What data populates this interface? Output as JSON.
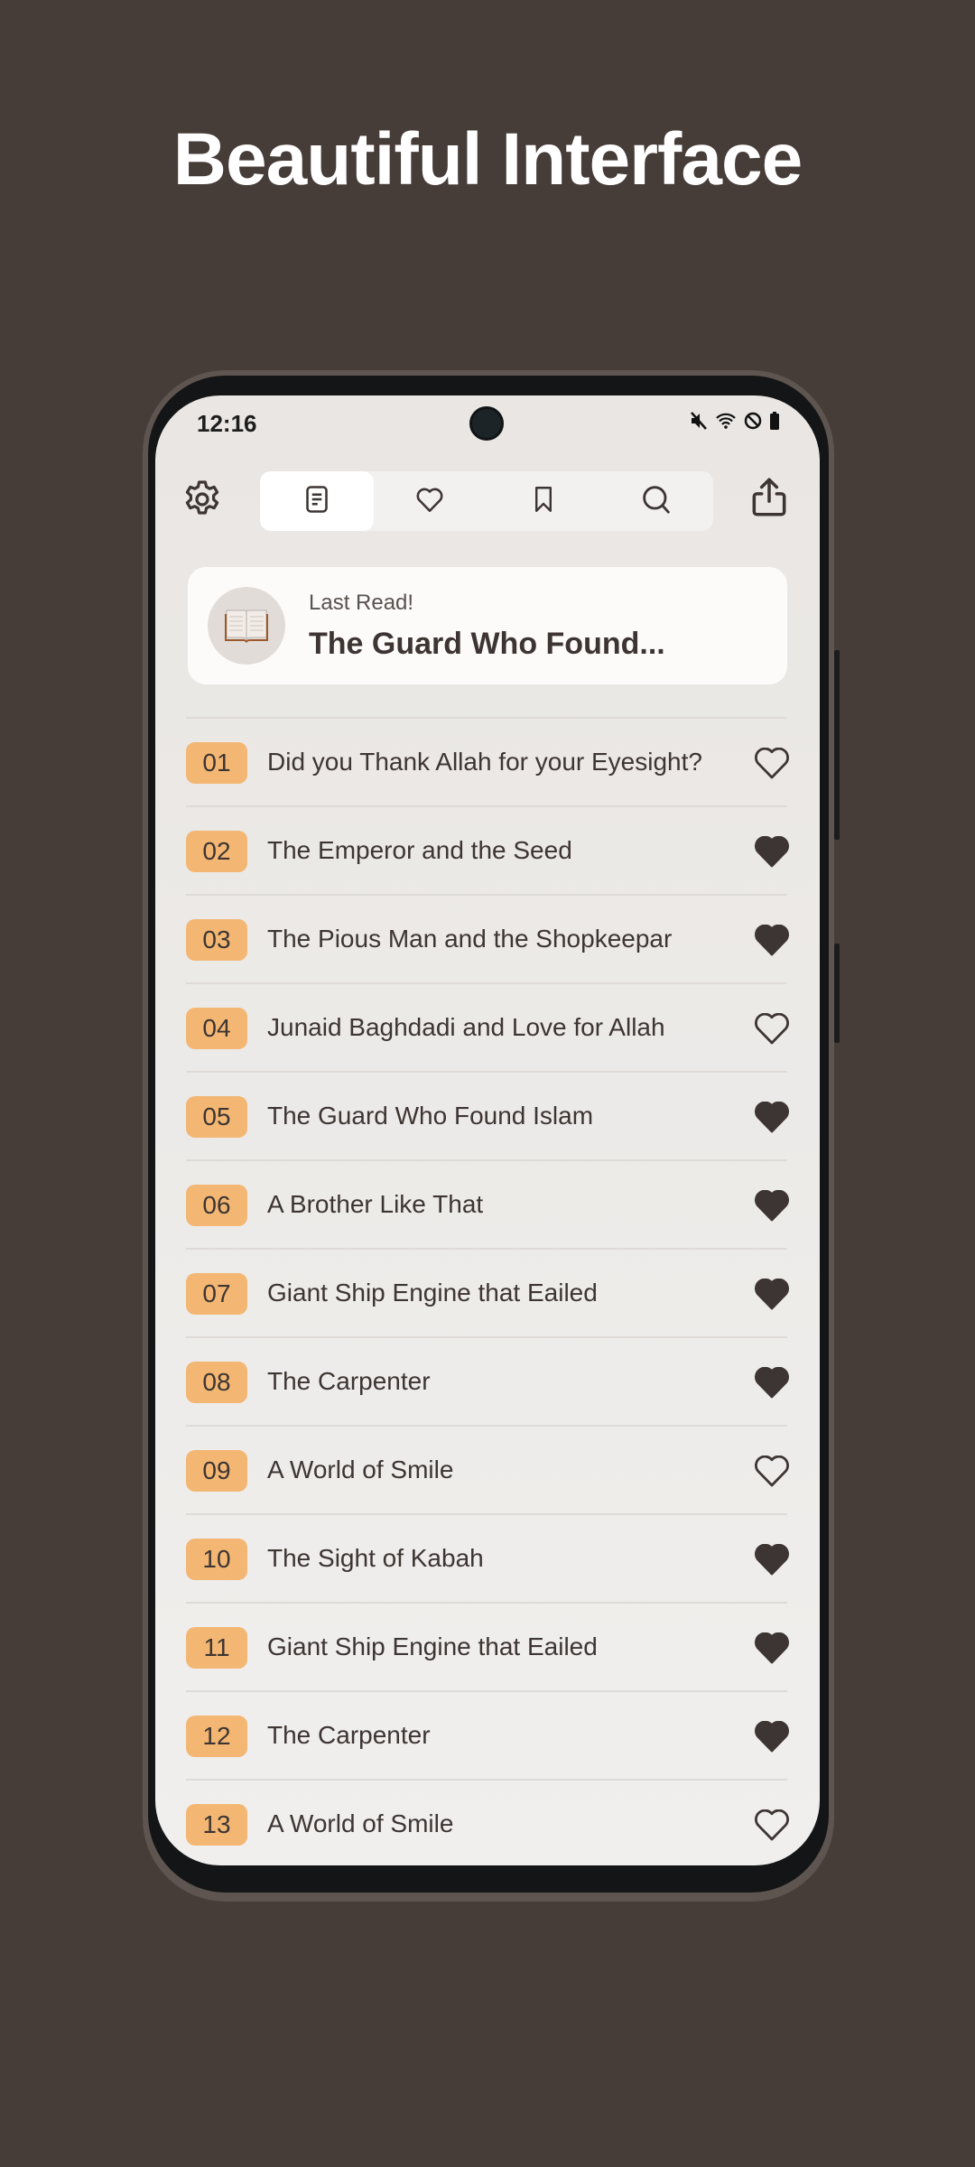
{
  "headline": "Beautiful Interface",
  "status_bar": {
    "time": "12:16",
    "icons": [
      "mute-icon",
      "wifi-icon",
      "do-not-disturb-icon",
      "battery-icon"
    ]
  },
  "toolbar": {
    "settings_icon": "gear-icon",
    "share_icon": "share-icon",
    "tabs": [
      {
        "name": "list",
        "icon": "document-list-icon",
        "active": true
      },
      {
        "name": "favorites",
        "icon": "heart-icon",
        "active": false
      },
      {
        "name": "bookmarks",
        "icon": "bookmark-icon",
        "active": false
      },
      {
        "name": "search",
        "icon": "search-icon",
        "active": false
      }
    ]
  },
  "last_read": {
    "label": "Last Read!",
    "title": "The Guard Who Found...",
    "icon": "open-book-icon"
  },
  "colors": {
    "accent_badge": "#f3b773",
    "text_dark": "#3d3533",
    "background": "#463c38"
  },
  "stories": [
    {
      "num": "01",
      "title": "Did you Thank Allah for your Eyesight?",
      "favorite": false
    },
    {
      "num": "02",
      "title": "The Emperor and the Seed",
      "favorite": true
    },
    {
      "num": "03",
      "title": "The Pious Man and the Shopkeepar",
      "favorite": true
    },
    {
      "num": "04",
      "title": "Junaid Baghdadi and Love for Allah",
      "favorite": false
    },
    {
      "num": "05",
      "title": "The Guard Who Found Islam",
      "favorite": true
    },
    {
      "num": "06",
      "title": "A Brother Like That",
      "favorite": true
    },
    {
      "num": "07",
      "title": "Giant Ship Engine that Eailed",
      "favorite": true
    },
    {
      "num": "08",
      "title": "The Carpenter",
      "favorite": true
    },
    {
      "num": "09",
      "title": "A World of Smile",
      "favorite": false
    },
    {
      "num": "10",
      "title": "The Sight of Kabah",
      "favorite": true
    },
    {
      "num": "11",
      "title": "Giant Ship Engine that Eailed",
      "favorite": true
    },
    {
      "num": "12",
      "title": "The Carpenter",
      "favorite": true
    },
    {
      "num": "13",
      "title": "A World of Smile",
      "favorite": false
    }
  ]
}
